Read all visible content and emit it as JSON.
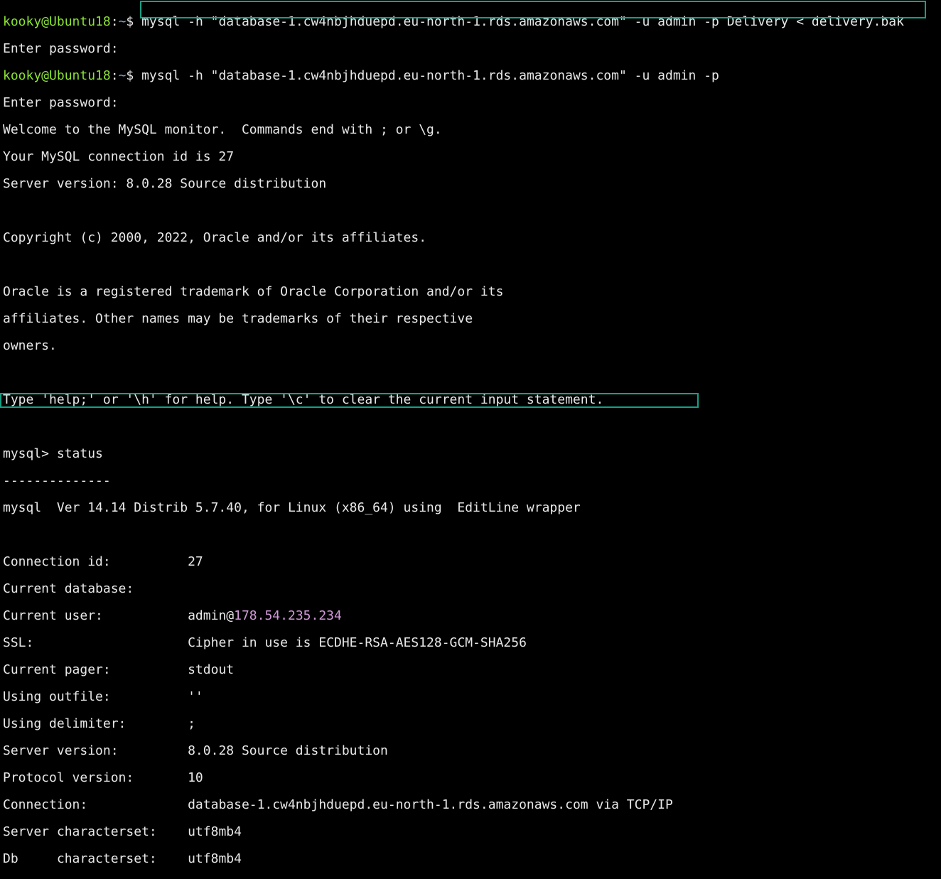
{
  "prompt": {
    "user_host": "kooky@Ubuntu18",
    "sep": ":",
    "path": "~",
    "dollar": "$ "
  },
  "cmd1": "mysql -h \"database-1.cw4nbjhduepd.eu-north-1.rds.amazonaws.com\" -u admin -p Delivery < delivery.bak",
  "enter_password": "Enter password:",
  "cmd2": "mysql -h \"database-1.cw4nbjhduepd.eu-north-1.rds.amazonaws.com\" -u admin -p",
  "welcome": "Welcome to the MySQL monitor.  Commands end with ; or \\g.",
  "conn_id_line": "Your MySQL connection id is 27",
  "server_version_line": "Server version: 8.0.28 Source distribution",
  "copyright": "Copyright (c) 2000, 2022, Oracle and/or its affiliates.",
  "trademark1": "Oracle is a registered trademark of Oracle Corporation and/or its",
  "trademark2": "affiliates. Other names may be trademarks of their respective",
  "trademark3": "owners.",
  "help": "Type 'help;' or '\\h' for help. Type '\\c' to clear the current input statement.",
  "mysql_prompt": "mysql> ",
  "status_cmd": "status",
  "dashes": "--------------",
  "client_version": "mysql  Ver 14.14 Distrib 5.7.40, for Linux (x86_64) using  EditLine wrapper",
  "status": {
    "connection_id": {
      "label": "Connection id:          ",
      "value": "27"
    },
    "current_database": {
      "label": "Current database:",
      "value": ""
    },
    "current_user": {
      "label": "Current user:           ",
      "value_user": "admin@",
      "value_ip": "178.54.235.234"
    },
    "ssl": {
      "label": "SSL:                    ",
      "value": "Cipher in use is ECDHE-RSA-AES128-GCM-SHA256"
    },
    "pager": {
      "label": "Current pager:          ",
      "value": "stdout"
    },
    "outfile": {
      "label": "Using outfile:          ",
      "value": "''"
    },
    "delimiter": {
      "label": "Using delimiter:        ",
      "value": ";"
    },
    "server_version": {
      "label": "Server version:         ",
      "value": "8.0.28 Source distribution"
    },
    "protocol_version": {
      "label": "Protocol version:       ",
      "value": "10"
    },
    "connection": {
      "label": "Connection:             ",
      "value": "database-1.cw4nbjhduepd.eu-north-1.rds.amazonaws.com via TCP/IP"
    },
    "server_charset": {
      "label": "Server characterset:    ",
      "value": "utf8mb4"
    },
    "db_charset": {
      "label": "Db     characterset:    ",
      "value": "utf8mb4"
    }
  }
}
